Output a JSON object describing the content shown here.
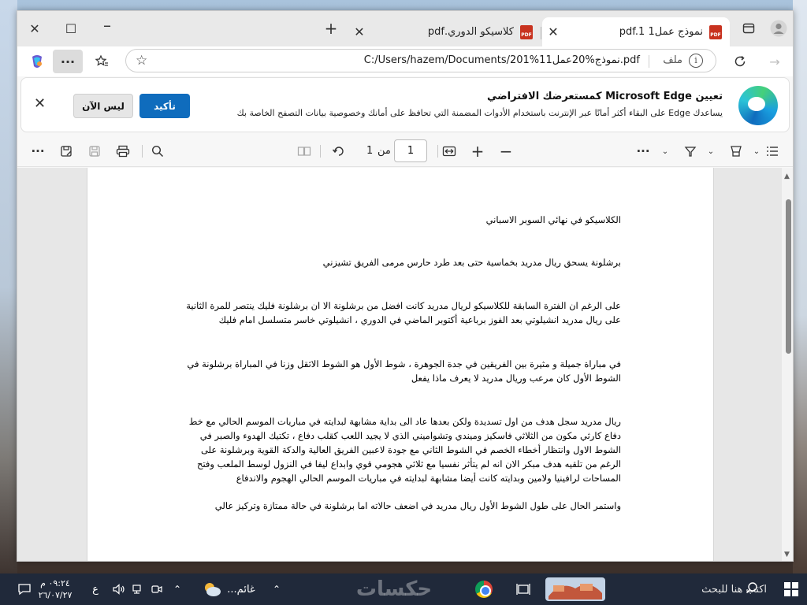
{
  "tabs": [
    {
      "label": "نموذج عمل1 pdf.1",
      "active": true
    },
    {
      "label": "كلاسيكو الدوري.pdf",
      "active": false
    }
  ],
  "pdf_badge_text": "PDF",
  "address": {
    "url": "C:/Users/hazem/Documents/201%1نموذج%20عمل1.pdf",
    "file_label": "ملف"
  },
  "notice": {
    "title": "تعيين Microsoft Edge كمستعرضك الافتراضي",
    "body": "يساعدك Edge على البقاء أكثر أمانًا عبر الإنترنت باستخدام الأدوات المضمنة التي تحافظ على أمانك وخصوصية بيانات التصفح الخاصة بك",
    "confirm_label": "تأكيد",
    "later_label": "ليس الآن"
  },
  "pdf_toolbar": {
    "page_current": "1",
    "page_of_label": "من",
    "page_total": "1"
  },
  "document": {
    "paragraphs": [
      "الكلاسيكو في نهائي السوبر الاسباني",
      "برشلونة يسحق ريال مدريد بخماسية حتى بعد طرد حارس مرمى الفريق تشيزني",
      "على الرغم ان الفترة السابقة للكلاسيكو لريال مدريد كانت افضل من برشلونة الا ان برشلونة فليك ينتصر للمرة الثانية على ريال مدريد انشيلوتي بعد الفوز برباعية أكتوبر الماضي في الدوري ، انشيلوتي خاسر متسلسل امام فليك",
      "في مباراة جميلة و مثيرة بين الفريقين في جدة الجوهرة ، شوط الأول هو الشوط الاثقل وزنا في المباراة برشلونة في الشوط الأول كان مرعب وريال مدريد لا يعرف ماذا يفعل",
      "ريال مدريد سجل هدف من اول تسديدة ولكن بعدها عاد الى بداية مشابهة لبدايته في مباريات الموسم الحالي مع خط دفاع كارثي مكون من الثلاثي فاسكيز وميندي وتشواميني الذي لا يجيد اللعب كقلب دفاع ، تكتيك الهدوء والصبر في الشوط الاول وانتظار أخطاء الخصم في الشوط الثاني مع جودة لاعبين الفريق العالية والدكة القوية وبرشلونة على الرغم من تلقيه هدف مبكر الان انه لم يتأثر نفسيا مع ثلاثي هجومي قوي وابداع ليفا في النزول لوسط الملعب وفتح المساحات لرافينيا ولامين وبدايته كانت أيضا مشابهة لبدايته في مباريات الموسم الحالي الهجوم والاندفاع",
      "واستمر الحال على طول الشوط الأول ريال مدريد في اضعف حالاته اما برشلونة في حالة ممتازة وتركيز عالي"
    ]
  },
  "taskbar": {
    "search_placeholder": "اكتب هنا للبحث",
    "weather": "غائم...",
    "time": "٠٩:٢٤ م",
    "date": "٢٦/٠٧/٢٧",
    "input_lang": "ع",
    "watermark": "حكسات"
  },
  "colors": {
    "edge_blue": "#0f6cbd",
    "taskbar": "#20293a",
    "pdf_red": "#c8321f"
  }
}
